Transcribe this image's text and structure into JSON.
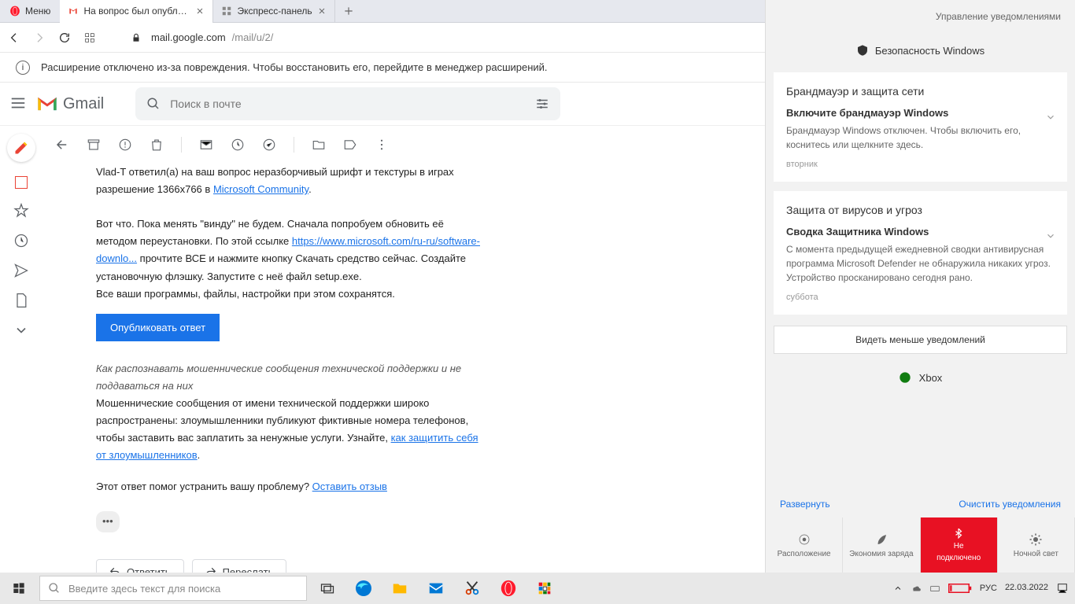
{
  "browser": {
    "menu_label": "Меню",
    "tabs": [
      {
        "title": "На вопрос был опублико",
        "active": true,
        "icon": "gmail"
      },
      {
        "title": "Экспресс-панель",
        "active": false,
        "icon": "grid"
      }
    ],
    "address": {
      "domain": "mail.google.com",
      "path": "/mail/u/2/"
    },
    "warning": "Расширение отключено из-за повреждения. Чтобы восстановить его, перейдите в менеджер расширений."
  },
  "gmail": {
    "brand": "Gmail",
    "search_placeholder": "Поиск в почте",
    "message": {
      "opener": "Vlad-T ответил(а) на ваш вопрос ",
      "question": "неразборчивый шрифт и текстуры в играх разрешение 1366x766",
      "question_suffix": " в ",
      "community_link": "Microsoft Community",
      "body1": "Вот что. Пока менять \"винду\" не будем. Сначала попробуем обновить её методом переустановки. По этой ссылке ",
      "link1": "https://www.microsoft.com/ru-ru/software-downlo...",
      "body2": " прочтите ВСЕ и нажмите кнопку Скачать средство сейчас. Создайте установочную флэшку. Запустите с неё файл setup.exe.",
      "body3": "Все ваши программы, файлы, настройки при этом сохранятся.",
      "publish_btn": "Опубликовать ответ",
      "scam_title": "Как распознавать мошеннические сообщения технической поддержки и не поддаваться на них",
      "scam_body": "Мошеннические сообщения от имени технической поддержки широко распространены: злоумышленники публикуют фиктивные номера телефонов, чтобы заставить вас заплатить за ненужные услуги. Узнайте, ",
      "scam_link": "как защитить себя от злоумышленников",
      "feedback_q": "Этот ответ помог устранить вашу проблему? ",
      "feedback_link": "Оставить отзыв",
      "reply_btn": "Ответить",
      "forward_btn": "Переслать"
    }
  },
  "notifications": {
    "header": "Управление уведомлениями",
    "security_title": "Безопасность Windows",
    "card1": {
      "title": "Брандмауэр и защита сети",
      "sub": "Включите брандмауэр Windows",
      "body": "Брандмауэр Windows отключен. Чтобы включить его, коснитесь или щелкните здесь.",
      "time": "вторник"
    },
    "card2": {
      "title": "Защита от вирусов и угроз",
      "sub": "Сводка Защитника Windows",
      "body": "С момента предыдущей ежедневной сводки антивирусная программа Microsoft Defender не обнаружила никаких угроз. Устройство просканировано сегодня рано.",
      "time": "суббота"
    },
    "less_btn": "Видеть меньше уведомлений",
    "xbox": "Xbox",
    "expand": "Развернуть",
    "clear": "Очистить уведомления",
    "qa": {
      "location": "Расположение",
      "battery": "Экономия заряда",
      "bt1": "Не",
      "bt2": "подключено",
      "night": "Ночной свет"
    }
  },
  "taskbar": {
    "search_placeholder": "Введите здесь текст для поиска",
    "lang": "РУС",
    "time": "",
    "date": "22.03.2022"
  }
}
